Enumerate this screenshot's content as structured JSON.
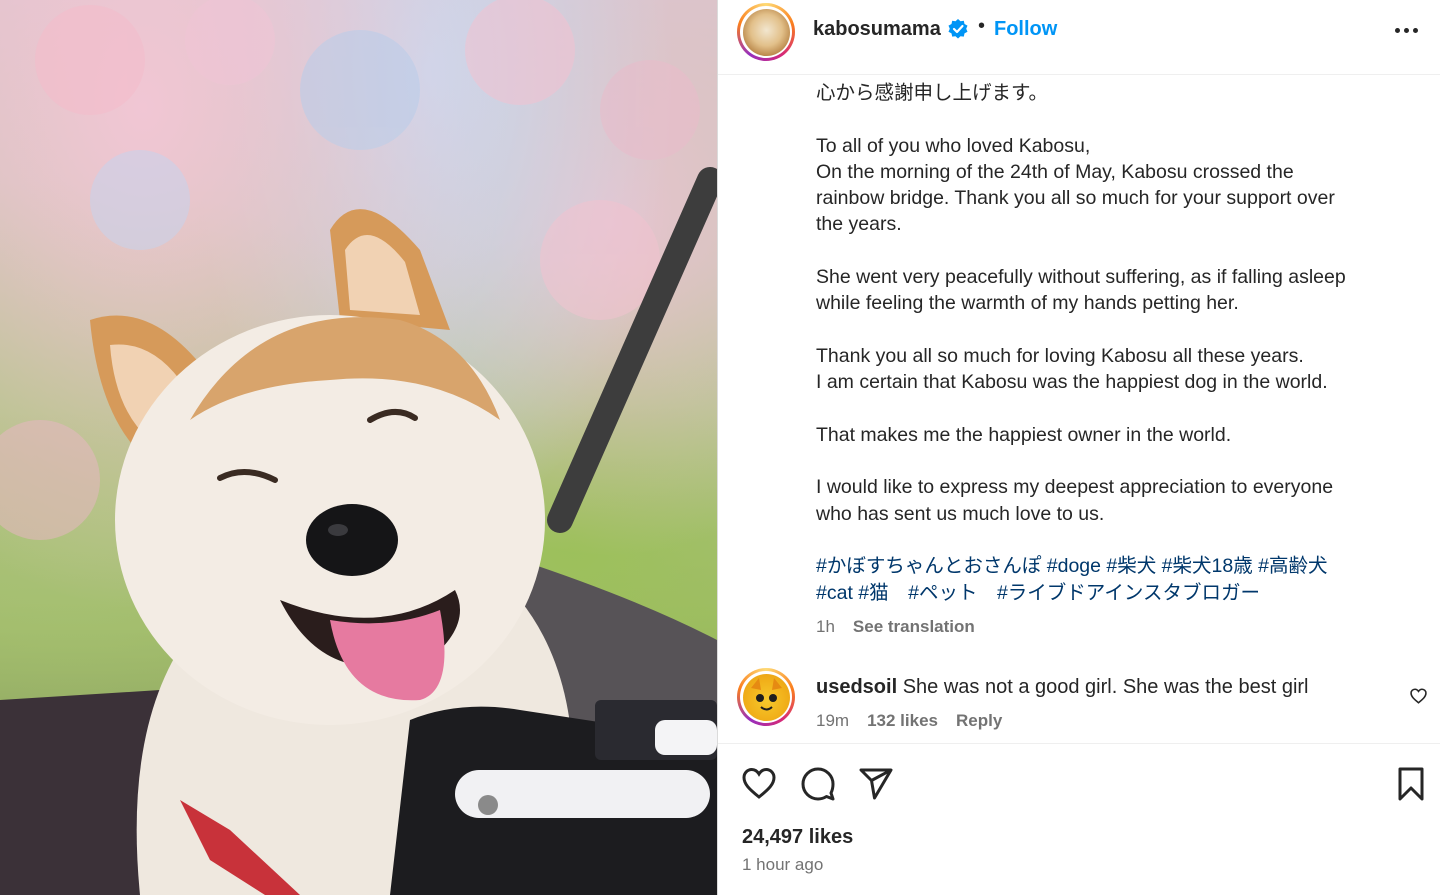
{
  "post": {
    "username": "kabosumama",
    "separator": "•",
    "follow_label": "Follow",
    "caption_lines": [
      "心から感謝申し上げます。",
      "",
      "To all of you who loved Kabosu,\nOn the morning of the 24th of May, Kabosu crossed the\nrainbow bridge. Thank you all so much for your support over\nthe years.",
      "",
      "She went very peacefully without suffering, as if falling asleep\nwhile feeling the warmth of my hands petting her.",
      "",
      "Thank you all so much for loving Kabosu all these years.\nI am certain that Kabosu was the happiest dog in the world.",
      "",
      "That makes me the happiest owner in the world.",
      "",
      "I would like to express my deepest appreciation to everyone\nwho has sent us much love to us."
    ],
    "hashtags": "#かぼすちゃんとおさんぽ #doge #柴犬 #柴犬18歳 #高齢犬\n#cat #猫　#ペット　#ライブドアインスタブロガー",
    "caption_time": "1h",
    "see_translation": "See translation"
  },
  "comment": {
    "username": "usedsoil",
    "text": "She was not a good girl. She was the best girl",
    "time": "19m",
    "likes": "132 likes",
    "reply": "Reply"
  },
  "footer": {
    "likes": "24,497 likes",
    "time_ago": "1 hour ago"
  },
  "icons": {
    "verified": "verified-badge-icon",
    "more": "more-options-icon",
    "like": "heart-icon",
    "comment": "comment-bubble-icon",
    "share": "paper-plane-icon",
    "save": "bookmark-icon"
  },
  "colors": {
    "link": "#0095f6",
    "hashtag": "#00376b",
    "muted": "#737373",
    "text": "#262626"
  }
}
